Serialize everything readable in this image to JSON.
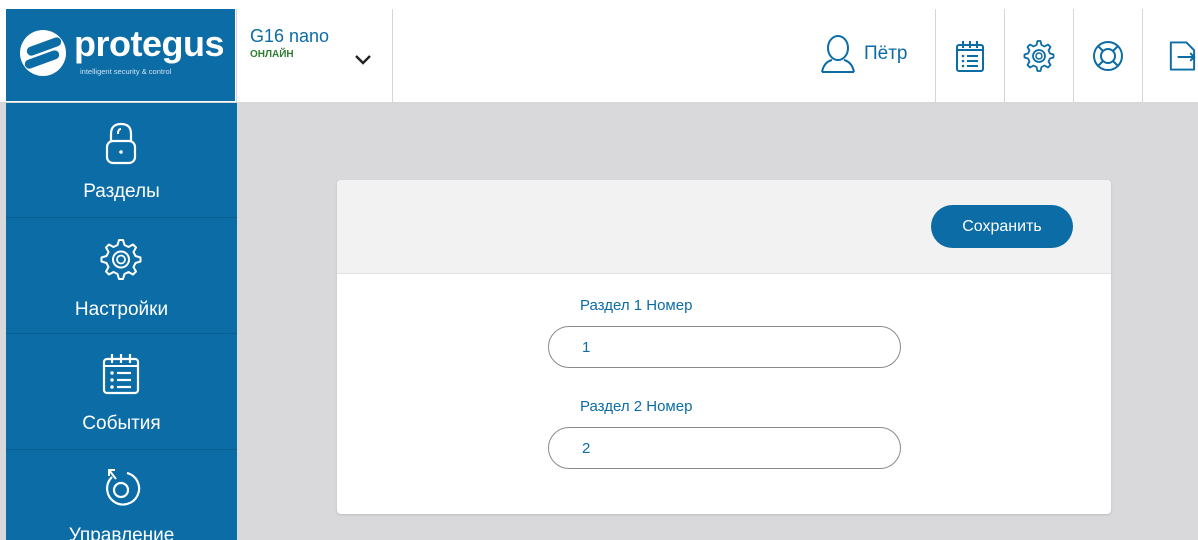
{
  "header": {
    "logo_text": "protegus",
    "logo_tagline": "intelligent security & control",
    "device": {
      "name": "G16 nano",
      "status": "ОНЛАЙН"
    },
    "user": {
      "name": "Пётр"
    }
  },
  "sidebar": {
    "items": [
      {
        "label": "Разделы",
        "icon": "lock-icon"
      },
      {
        "label": "Настройки",
        "icon": "gear-icon"
      },
      {
        "label": "События",
        "icon": "events-list-icon"
      },
      {
        "label": "Управление",
        "icon": "control-icon"
      }
    ]
  },
  "form": {
    "save_label": "Сохранить",
    "fields": [
      {
        "label": "Раздел 1 Номер",
        "value": "1"
      },
      {
        "label": "Раздел 2 Номер",
        "value": "2"
      }
    ]
  },
  "colors": {
    "brand": "#0b6ca6",
    "online": "#2e7d32",
    "background": "#d9d9db"
  }
}
